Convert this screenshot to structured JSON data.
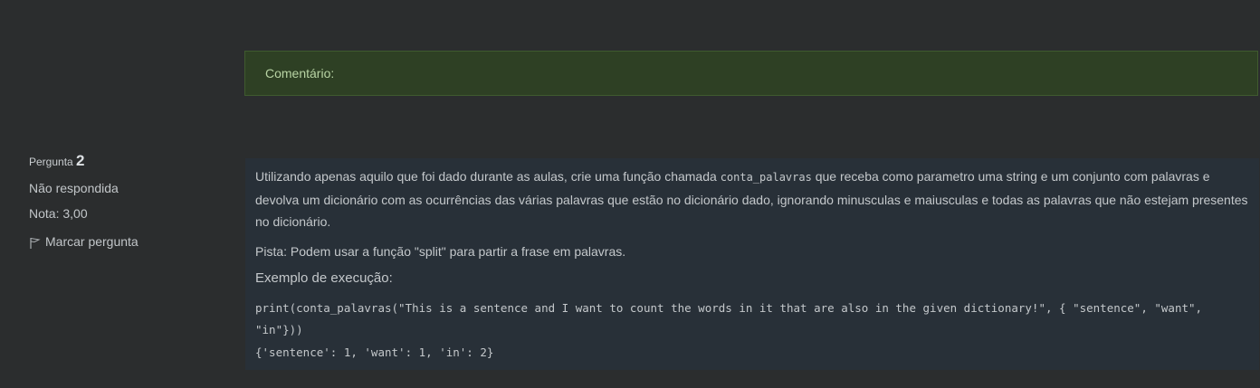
{
  "comment": {
    "label": "Comentário:"
  },
  "question": {
    "prefix": "Pergunta",
    "number": "2",
    "status": "Não respondida",
    "grade": "Nota: 3,00",
    "flag_label": "Marcar pergunta",
    "text_before_code": "Utilizando apenas aquilo que foi dado durante as aulas, crie uma função chamada ",
    "function_name": "conta_palavras",
    "text_after_code": " que receba como parametro uma string e um conjunto com palavras e devolva um dicionário com as ocurrências das várias palavras que estão no dicionário dado, ignorando minusculas e maiusculas e todas as palavras que não estejam presentes no dicionário.",
    "hint": "Pista: Podem usar a função \"split\" para partir a frase em palavras.",
    "example_title": "Exemplo de execução:",
    "example_code": "print(conta_palavras(\"This is a sentence and I want to count the words in it that are also in the given dictionary!\", { \"sentence\", \"want\", \"in\"}))",
    "example_output": "{'sentence': 1, 'want': 1, 'in': 2}"
  }
}
